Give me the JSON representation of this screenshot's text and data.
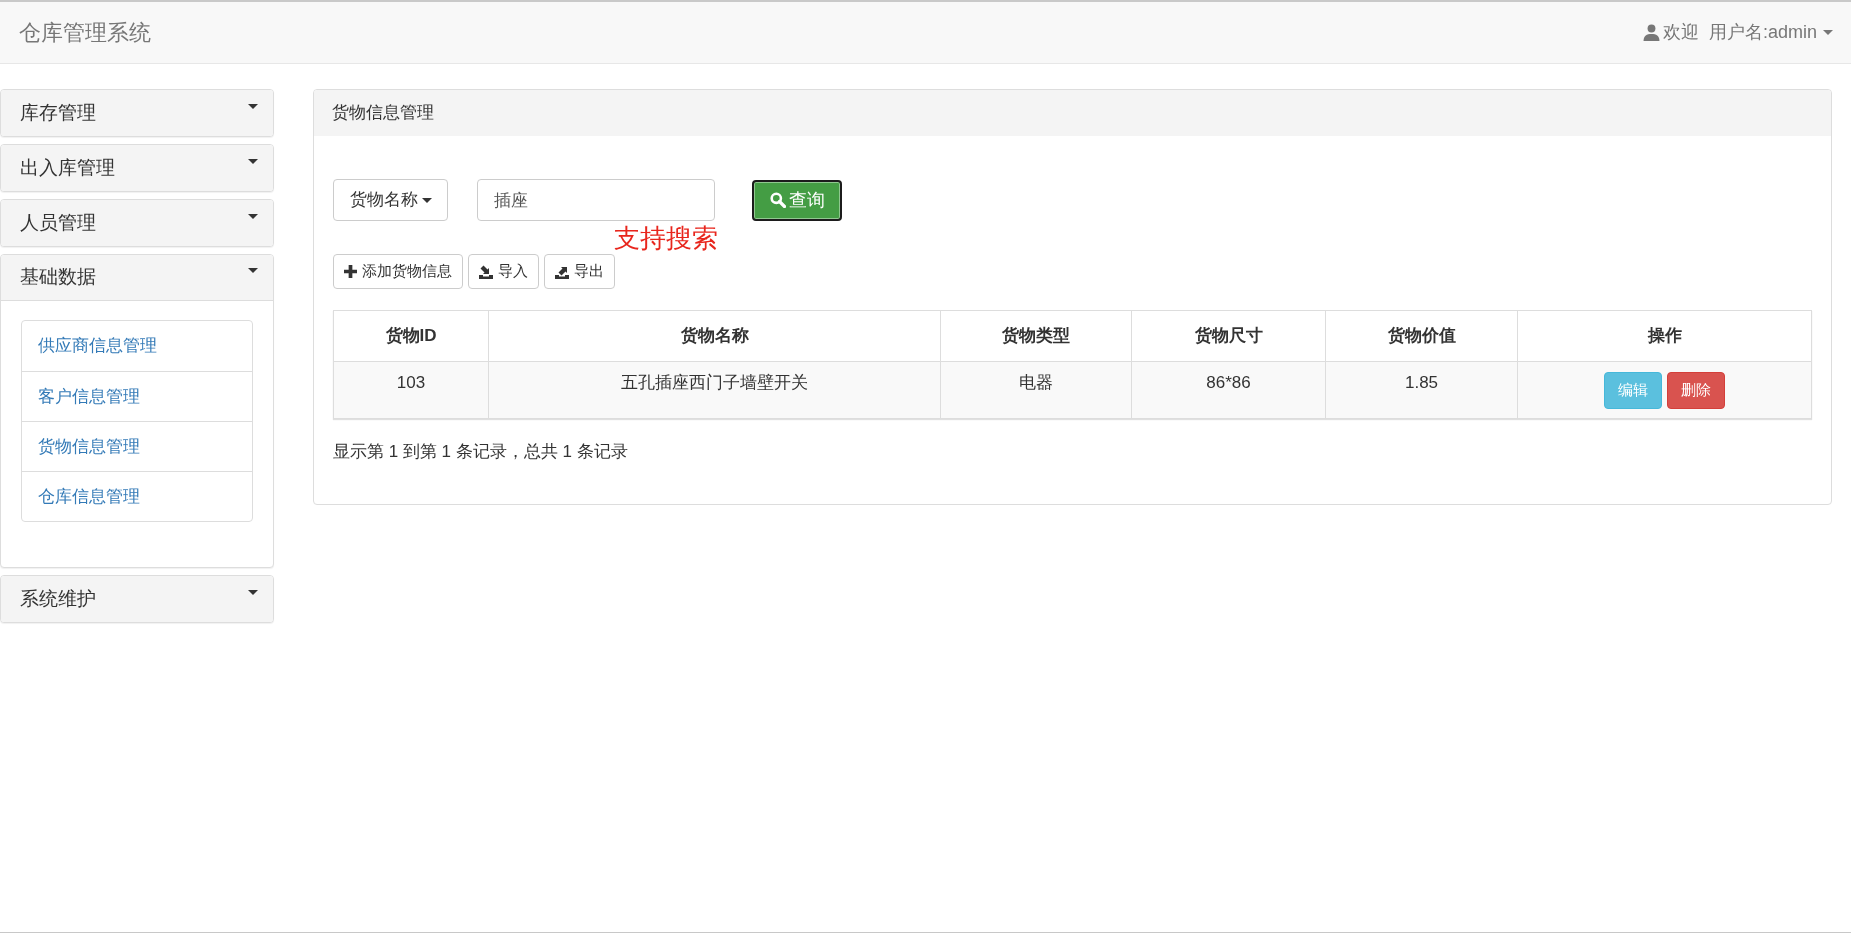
{
  "navbar": {
    "brand": "仓库管理系统",
    "greeting": "欢迎",
    "username": "用户名:admin"
  },
  "sidebar": {
    "panels": [
      {
        "title": "库存管理",
        "expanded": false
      },
      {
        "title": "出入库管理",
        "expanded": false
      },
      {
        "title": "人员管理",
        "expanded": false
      },
      {
        "title": "基础数据",
        "expanded": true,
        "items": [
          {
            "label": "供应商信息管理"
          },
          {
            "label": "客户信息管理"
          },
          {
            "label": "货物信息管理"
          },
          {
            "label": "仓库信息管理"
          }
        ]
      },
      {
        "title": "系统维护",
        "expanded": false
      }
    ]
  },
  "main_panel": {
    "title": "货物信息管理",
    "search": {
      "field_label": "货物名称",
      "value": "插座",
      "button_label": "查询",
      "button_focused": true,
      "note": "支持搜索"
    },
    "toolbar": [
      {
        "kind": "add",
        "label": "添加货物信息"
      },
      {
        "kind": "import",
        "label": "导入"
      },
      {
        "kind": "export",
        "label": "导出"
      }
    ],
    "table": {
      "columns": [
        "货物ID",
        "货物名称",
        "货物类型",
        "货物尺寸",
        "货物价值",
        "操作"
      ],
      "rows": [
        {
          "cells": [
            "103",
            "五孔插座西门子墙壁开关",
            "电器",
            "86*86",
            "1.85"
          ],
          "actions": [
            {
              "kind": "edit",
              "label": "编辑"
            },
            {
              "kind": "delete",
              "label": "删除"
            }
          ]
        }
      ]
    },
    "record_summary": "显示第 1 到第 1 条记录，总共 1 条记录"
  }
}
